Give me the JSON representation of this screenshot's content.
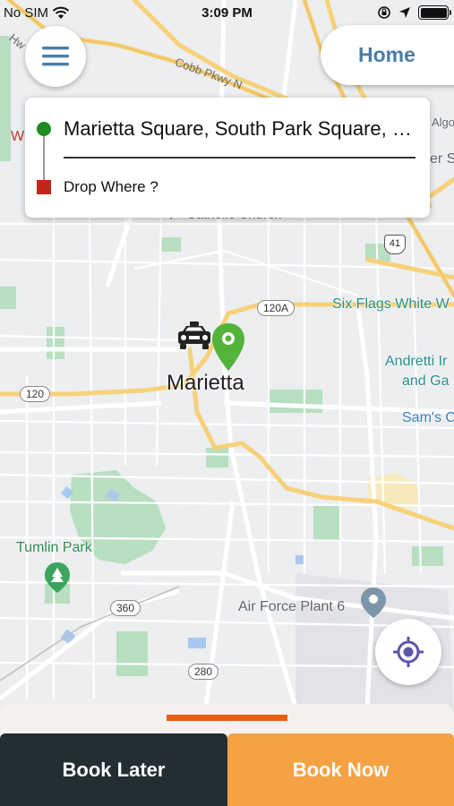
{
  "status_bar": {
    "carrier": "No SIM",
    "time": "3:09 PM",
    "icons": [
      "wifi-icon",
      "orientation-lock-icon",
      "location-arrow-icon",
      "battery-icon"
    ]
  },
  "header": {
    "menu_icon": "hamburger-menu-icon",
    "home_label": "Home"
  },
  "address_card": {
    "pickup": "Marietta Square, South Park Square, Marietta, GA, USA",
    "dropoff_placeholder": "Drop Where ?"
  },
  "map": {
    "city": "Marietta",
    "places": {
      "six_flags": "Six Flags White W",
      "andretti_1": "Andretti Ir",
      "andretti_2": "and Ga",
      "sams": "Sam's C",
      "tumlin": "Tumlin Park",
      "air_force": "Air Force Plant 6",
      "church": "Catholic Church",
      "w_partial": "W",
      "er_partial": "er S",
      "algo_partial": "Algo",
      "hw_partial": "Hw"
    },
    "roads": {
      "cobb": "Cobb Pkwy N"
    },
    "shields": {
      "r120a": "120A",
      "r120": "120",
      "r360": "360",
      "r280": "280",
      "us41": "41"
    }
  },
  "bottom": {
    "book_later": "Book Later",
    "book_now": "Book Now"
  },
  "colors": {
    "brand_blue": "#4a7da6",
    "pickup_green": "#1f8c1f",
    "drop_red": "#c0261a",
    "book_later_bg": "#232e32",
    "book_now_bg": "#f5a245",
    "handle_orange": "#ef5d13"
  }
}
